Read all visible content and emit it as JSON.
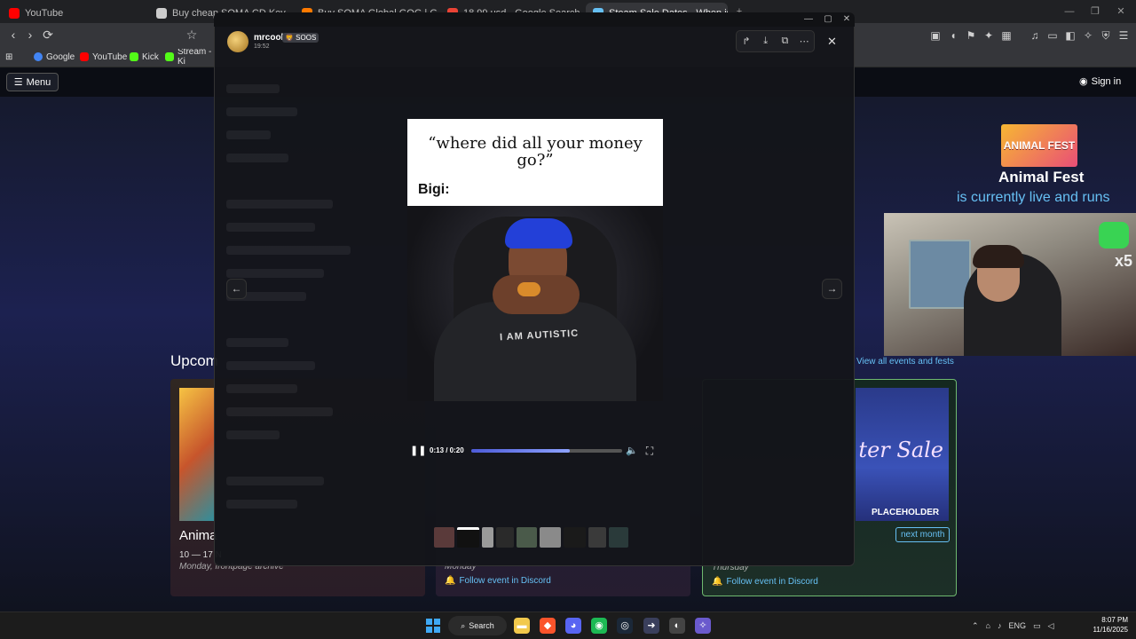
{
  "browser": {
    "tabs": [
      {
        "title": "YouTube",
        "color": "#ff0000"
      },
      {
        "title": "Buy cheap SOMA CD Key 🔑 Best Pr",
        "color": "#cccccc"
      },
      {
        "title": "Buy SOMA Global GOG | GAMIVO",
        "color": "#ff7a00"
      },
      {
        "title": "18.99 usd - Google Search",
        "color": "#ea4335"
      },
      {
        "title": "Steam Sale Dates - When is the",
        "color": "#66c0f4"
      }
    ],
    "new_tab": "+",
    "window_buttons": {
      "minimize": "—",
      "restore": "❐",
      "close": "✕"
    },
    "nav": {
      "back": "‹",
      "forward": "›",
      "reload": "⟳",
      "bookmark": "☆"
    },
    "bookmarks": [
      {
        "label": "Google",
        "color": "#4285f4"
      },
      {
        "label": "YouTube",
        "color": "#ff0000"
      },
      {
        "label": "Kick",
        "color": "#53fc18"
      },
      {
        "label": "Stream - Ki",
        "color": "#53fc18"
      }
    ],
    "apps_icon": "⊞",
    "extensions": [
      "▣",
      "◖",
      "⚑",
      "✦",
      "▦",
      "♫",
      "▭",
      "◧",
      "✧",
      "⛨",
      "☰"
    ]
  },
  "steam": {
    "menu_label": "Menu",
    "signin_label": "Sign in",
    "featured": {
      "logo_text": "ANIMAL FEST",
      "title": "Animal Fest",
      "subtitle": "is currently live and runs"
    },
    "webcam_overlay": "x5",
    "view_all": "View all events and fests",
    "upcoming_label": "Upcom",
    "cards": [
      {
        "name": "Anima",
        "date": "10 — 17 N",
        "sub": "Monday, frontpage archive",
        "follow": ""
      },
      {
        "name": "",
        "date": "",
        "sub": "Monday",
        "follow": "Follow event in Discord"
      },
      {
        "name": "",
        "date": "",
        "sub": "Thursday",
        "follow": "Follow event in Discord",
        "art_text": "ter Sale",
        "placeholder": "PLACEHOLDER",
        "next_month": "next month"
      }
    ]
  },
  "discord": {
    "window_buttons": {
      "minimize": "—",
      "maximize": "▢",
      "close": "✕"
    },
    "author": {
      "name": "mrcool",
      "tag": "🦁 SOOS",
      "time": "19:52"
    },
    "media_actions": [
      {
        "name": "forward-icon",
        "glyph": "↱"
      },
      {
        "name": "download-icon",
        "glyph": "⤓"
      },
      {
        "name": "open-external-icon",
        "glyph": "⧉"
      },
      {
        "name": "more-icon",
        "glyph": "⋯"
      }
    ],
    "close_glyph": "✕",
    "prev_glyph": "←",
    "next_glyph": "→",
    "video": {
      "caption_quote": "“where did all your money go?”",
      "caption_label": "Bigi:",
      "shirt_text": "I AM AUTISTIC",
      "time": "0:13 / 0:20",
      "progress": 0.65,
      "play_glyph": "❚❚",
      "volume_glyph": "🔈",
      "fullscreen_glyph": "⛶"
    },
    "thumbnails": [
      {
        "color": "#5a3a3a"
      },
      {
        "color": "#111111"
      },
      {
        "color": "#9a9a9a"
      },
      {
        "color": "#2a2a2a"
      },
      {
        "color": "#4a5a4a"
      },
      {
        "color": "#8a8a8a"
      },
      {
        "color": "#1a1a1a"
      },
      {
        "color": "#3a3a3a"
      },
      {
        "color": "#2a3a3a"
      }
    ]
  },
  "taskbar": {
    "search_label": "Search",
    "apps": [
      {
        "name": "file-explorer-icon",
        "glyph": "▬",
        "color": "#f2c94c"
      },
      {
        "name": "brave-icon",
        "glyph": "◆",
        "color": "#fb542b"
      },
      {
        "name": "discord-icon",
        "glyph": "◕",
        "color": "#5865f2"
      },
      {
        "name": "spotify-icon",
        "glyph": "◉",
        "color": "#1db954"
      },
      {
        "name": "steam-icon",
        "glyph": "◎",
        "color": "#1b2838"
      },
      {
        "name": "app-icon",
        "glyph": "➜",
        "color": "#3a3f5c"
      },
      {
        "name": "obs-icon",
        "glyph": "◐",
        "color": "#444444"
      },
      {
        "name": "ai-app-icon",
        "glyph": "✧",
        "color": "#6a5acd"
      }
    ],
    "tray": {
      "chevron": "⌃",
      "language": "ENG"
    },
    "clock": {
      "time": "8:07 PM",
      "date": "11/16/2025"
    }
  }
}
